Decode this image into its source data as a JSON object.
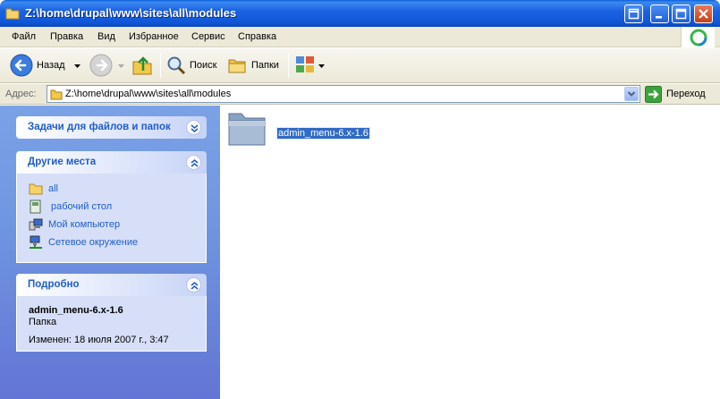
{
  "window": {
    "title": "Z:\\home\\drupal\\www\\sites\\all\\modules"
  },
  "menu": [
    "Файл",
    "Правка",
    "Вид",
    "Избранное",
    "Сервис",
    "Справка"
  ],
  "toolbar": {
    "back_label": "Назад",
    "search_label": "Поиск",
    "folders_label": "Папки"
  },
  "address": {
    "label": "Адрес:",
    "value": "Z:\\home\\drupal\\www\\sites\\all\\modules",
    "go_label": "Переход"
  },
  "tasks_panel": {
    "title": "Задачи для файлов и папок"
  },
  "places_panel": {
    "title": "Другие места",
    "items": [
      {
        "label": "all",
        "icon": "folder-icon"
      },
      {
        "label": "рабочий стол",
        "icon": "desktop-icon"
      },
      {
        "label": "Мой компьютер",
        "icon": "computer-icon"
      },
      {
        "label": "Сетевое окружение",
        "icon": "network-icon"
      }
    ]
  },
  "details_panel": {
    "title": "Подробно",
    "name": "admin_menu-6.x-1.6",
    "type": "Папка",
    "modified": "Изменен: 18 июля 2007 г., 3:47"
  },
  "files": [
    {
      "name": "admin_menu-6.x-1.6",
      "icon": "folder-icon",
      "selected": true
    }
  ],
  "colors": {
    "title_bar": "#0f56d6",
    "task_pane": "#7ba2e7",
    "panel_title": "#215dc6",
    "selection": "#316ac5"
  }
}
